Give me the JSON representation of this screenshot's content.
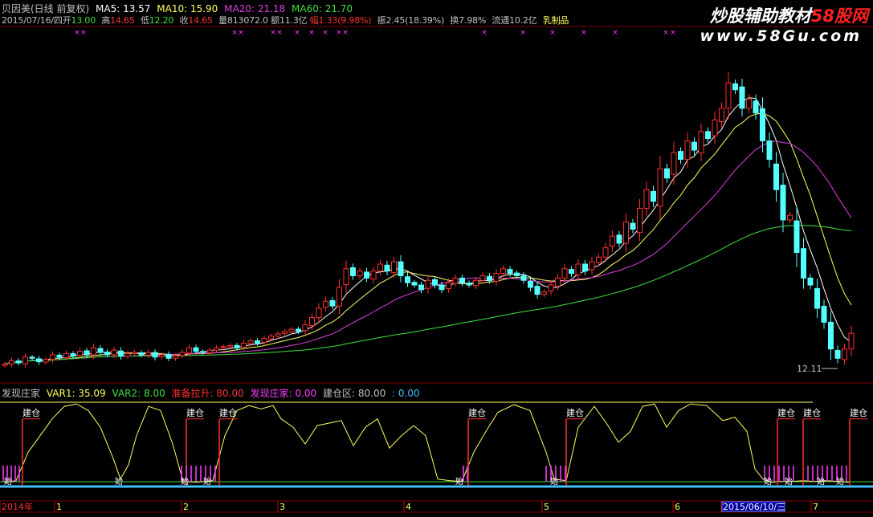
{
  "header": {
    "title": "贝因美(日线 前复权)",
    "ma5": "MA5: 13.57",
    "ma10": "MA10: 15.90",
    "ma20": "MA20: 21.18",
    "ma60": "MA60: 21.70",
    "line2": {
      "date": "2015/07/16/四",
      "open_label": "开",
      "open": "13.00",
      "high_label": "高",
      "high": "14.65",
      "low_label": "低",
      "low": "12.20",
      "close_label": "收",
      "close": "14.65",
      "volume": "量813072.0",
      "amount": "额11.3亿",
      "change": "幅1.33(9.98%)",
      "amplitude": "振2.45(18.39%)",
      "turnover": "换7.98%",
      "float": "流通10.2亿",
      "sector": "乳制品"
    }
  },
  "watermark": {
    "main": "炒股辅助教材",
    "main_red": "58股网",
    "url": "www.58Gu.com"
  },
  "low_label": "12.11",
  "indicator": {
    "name": "发现庄家",
    "var1": "VAR1: 35.09",
    "var2": "VAR2: 8.00",
    "prepare": "准备拉升: 80.00",
    "found": "发现庄家: 0.00",
    "build_zone": "建仓区: 80.00",
    "extra": ": 0.00",
    "label_build": "建仓",
    "label_start": "始"
  },
  "xaxis": {
    "labels": [
      "2014年",
      "1",
      "2",
      "3",
      "4",
      "5",
      "6",
      "2015/06/10/三",
      "7"
    ]
  },
  "colors": {
    "up": "#ff3030",
    "down": "#54ffff",
    "ma5": "#ffffff",
    "ma10": "#ffff60",
    "ma20": "#e040e0",
    "ma60": "#40e040",
    "var1": "#ffff60",
    "build": "#ff3030",
    "start": "#ff40ff",
    "baseline": "#40c0ff",
    "greenline": "#40e040"
  },
  "chart_data": {
    "type": "candlestick",
    "close": [
      12.0,
      12.3,
      12.1,
      12.6,
      12.5,
      12.2,
      12.4,
      12.8,
      12.6,
      12.9,
      12.7,
      13.1,
      12.8,
      13.4,
      13.0,
      12.8,
      13.2,
      12.7,
      12.9,
      13.0,
      12.8,
      13.0,
      12.6,
      12.8,
      12.5,
      12.7,
      13.0,
      13.4,
      13.1,
      13.0,
      13.2,
      13.4,
      13.5,
      13.6,
      13.4,
      13.8,
      14.0,
      13.8,
      14.2,
      14.4,
      14.6,
      14.8,
      15.0,
      14.8,
      15.4,
      16.0,
      16.8,
      17.4,
      17.0,
      18.6,
      20.2,
      19.6,
      20.0,
      19.4,
      20.0,
      20.6,
      20.0,
      20.8,
      19.6,
      19.0,
      18.8,
      18.4,
      19.2,
      18.8,
      18.4,
      19.0,
      19.4,
      19.0,
      18.8,
      19.2,
      19.6,
      19.2,
      19.8,
      20.2,
      19.8,
      19.6,
      19.2,
      18.6,
      18.0,
      18.2,
      18.8,
      19.4,
      20.2,
      19.8,
      20.6,
      20.0,
      20.8,
      21.2,
      22.0,
      23.0,
      22.4,
      24.2,
      23.6,
      25.4,
      27.0,
      26.0,
      28.8,
      28.0,
      30.2,
      29.6,
      31.2,
      30.4,
      32.0,
      31.4,
      33.0,
      34.0,
      36.2,
      35.6,
      34.0,
      34.8,
      33.6,
      31.2,
      29.6,
      27.0,
      24.4,
      24.8,
      21.6,
      19.4,
      18.8,
      16.8,
      15.6,
      13.3,
      12.5,
      13.3,
      14.65
    ]
  }
}
